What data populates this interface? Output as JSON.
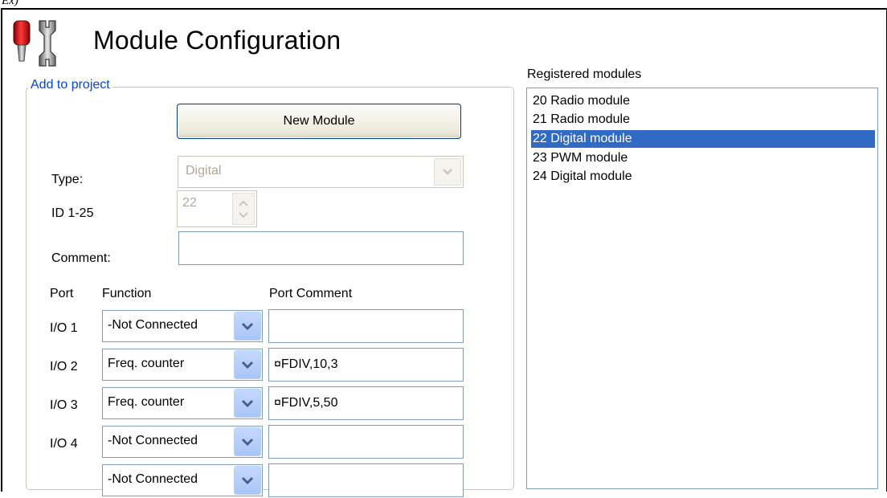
{
  "caption": "Ex)",
  "window": {
    "title": "Module Configuration",
    "icon": "tools-icon"
  },
  "add_group": {
    "legend": "Add to project",
    "new_button": "New Module",
    "type_label": "Type:",
    "type_value": "Digital",
    "id_label": "ID 1-25",
    "id_value": "22",
    "comment_label": "Comment:",
    "comment_value": ""
  },
  "ports": {
    "col_port": "Port",
    "col_function": "Function",
    "col_comment": "Port Comment",
    "rows": [
      {
        "port": "I/O 1",
        "function": "-Not Connected",
        "comment": ""
      },
      {
        "port": "I/O 2",
        "function": "Freq. counter",
        "comment": "¤FDIV,10,3"
      },
      {
        "port": "I/O 3",
        "function": "Freq. counter",
        "comment": "¤FDIV,5,50"
      },
      {
        "port": "I/O 4",
        "function": "-Not Connected",
        "comment": ""
      },
      {
        "port": "",
        "function": "-Not Connected",
        "comment": ""
      }
    ]
  },
  "registered": {
    "label": "Registered modules",
    "items": [
      {
        "text": "20  Radio module",
        "selected": false
      },
      {
        "text": "21  Radio module",
        "selected": false
      },
      {
        "text": "22  Digital module",
        "selected": true
      },
      {
        "text": "23  PWM module",
        "selected": false
      },
      {
        "text": "24  Digital module",
        "selected": false
      }
    ]
  },
  "colors": {
    "accent_blue": "#0046d5",
    "selection": "#316ac5",
    "dropdown_button": "#a8c5f6"
  }
}
